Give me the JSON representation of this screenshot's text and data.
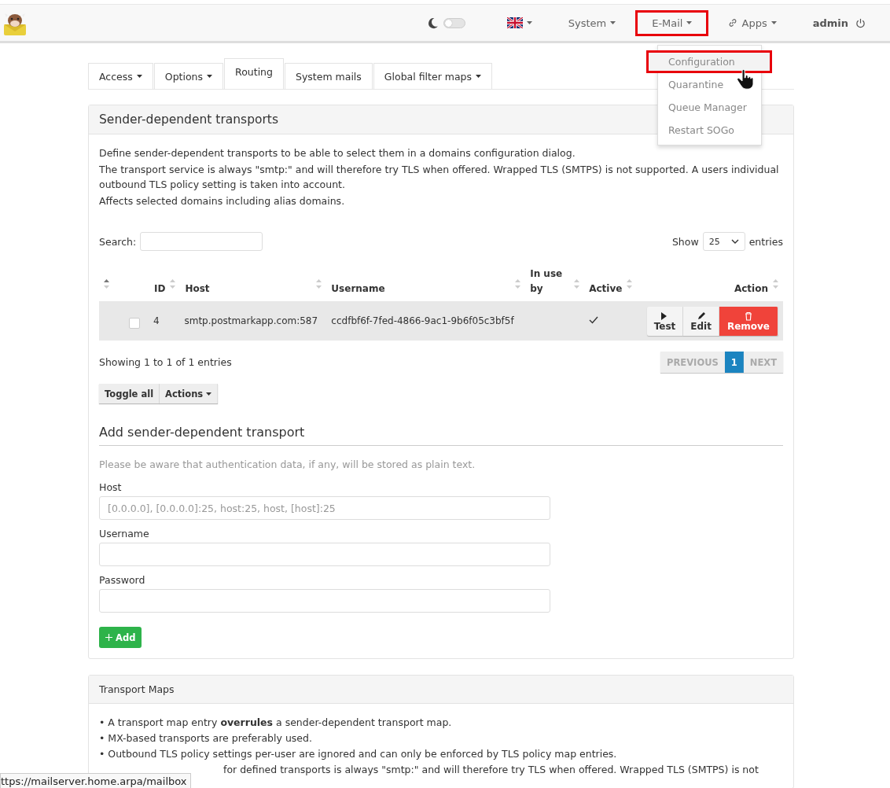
{
  "topbar": {
    "theme_toggle": {
      "on": false
    },
    "nav": [
      {
        "label": "System",
        "annotated": false
      },
      {
        "label": "E-Mail",
        "annotated": true
      },
      {
        "label": "Apps",
        "annotated": false
      }
    ],
    "user": "admin"
  },
  "email_menu": {
    "items": [
      {
        "label": "Configuration",
        "annotated": true,
        "hovered": true
      },
      {
        "label": "Quarantine",
        "annotated": false,
        "hovered": false
      },
      {
        "label": "Queue Manager",
        "annotated": false,
        "hovered": false
      },
      {
        "label": "Restart SOGo",
        "annotated": false,
        "hovered": false
      }
    ]
  },
  "tabs": [
    {
      "label": "Access",
      "dropdown": true,
      "selected": false
    },
    {
      "label": "Options",
      "dropdown": true,
      "selected": false
    },
    {
      "label": "Routing",
      "dropdown": false,
      "selected": true
    },
    {
      "label": "System mails",
      "dropdown": false,
      "selected": false
    },
    {
      "label": "Global filter maps",
      "dropdown": true,
      "selected": false
    }
  ],
  "panel": {
    "title": "Sender-dependent transports",
    "description": [
      "Define sender-dependent transports to be able to select them in a domains configuration dialog.",
      "The transport service is always \"smtp:\" and will therefore try TLS when offered. Wrapped TLS (SMTPS) is not supported. A users individual outbound TLS policy setting is taken into account.",
      "Affects selected domains including alias domains."
    ],
    "search_label": "Search:",
    "show_label": "Show",
    "page_size": "25",
    "entries_label": "entries",
    "table": {
      "columns": [
        {
          "label": "ID"
        },
        {
          "label": "Host"
        },
        {
          "label": "Username"
        },
        {
          "label": "In use by"
        },
        {
          "label": "Active"
        },
        {
          "label": "Action"
        }
      ],
      "rows": [
        {
          "checked": false,
          "id": "4",
          "host": "smtp.postmarkapp.com:587",
          "username": "ccdfbf6f-7fed-4866-9ac1-9b6f05c3bf5f",
          "active": true,
          "actions": [
            {
              "kind": "test",
              "label": "Test"
            },
            {
              "kind": "edit",
              "label": "Edit"
            },
            {
              "kind": "remove",
              "label": "Remove"
            }
          ]
        }
      ]
    },
    "info": "Showing 1 to 1 of 1 entries",
    "pagination": [
      {
        "label": "PREVIOUS",
        "selected": false,
        "disabled": true
      },
      {
        "label": "1",
        "selected": true,
        "disabled": false
      },
      {
        "label": "NEXT",
        "selected": false,
        "disabled": true
      }
    ],
    "bulk": [
      {
        "label": "Toggle all",
        "dropdown": false
      },
      {
        "label": "Actions",
        "dropdown": true
      }
    ],
    "add": {
      "title": "Add sender-dependent transport",
      "note": "Please be aware that authentication data, if any, will be stored as plain text.",
      "fields": [
        {
          "label": "Host",
          "placeholder": "[0.0.0.0], [0.0.0.0]:25, host:25, host, [host]:25"
        },
        {
          "label": "Username"
        },
        {
          "label": "Password"
        }
      ],
      "button": "Add"
    }
  },
  "transport_maps": {
    "title": "Transport Maps",
    "bullets": [
      "• A transport map entry **overrules** a sender-dependent transport map.",
      "• MX-based transports are preferably used.",
      "• Outbound TLS policy settings per-user are ignored and can only be enforced by TLS policy map entries.",
      "for defined transports is always \"smtp:\" and will therefore try TLS when offered. Wrapped TLS (SMTPS) is not"
    ]
  },
  "status_url": "ttps://mailserver.home.arpa/mailbox"
}
